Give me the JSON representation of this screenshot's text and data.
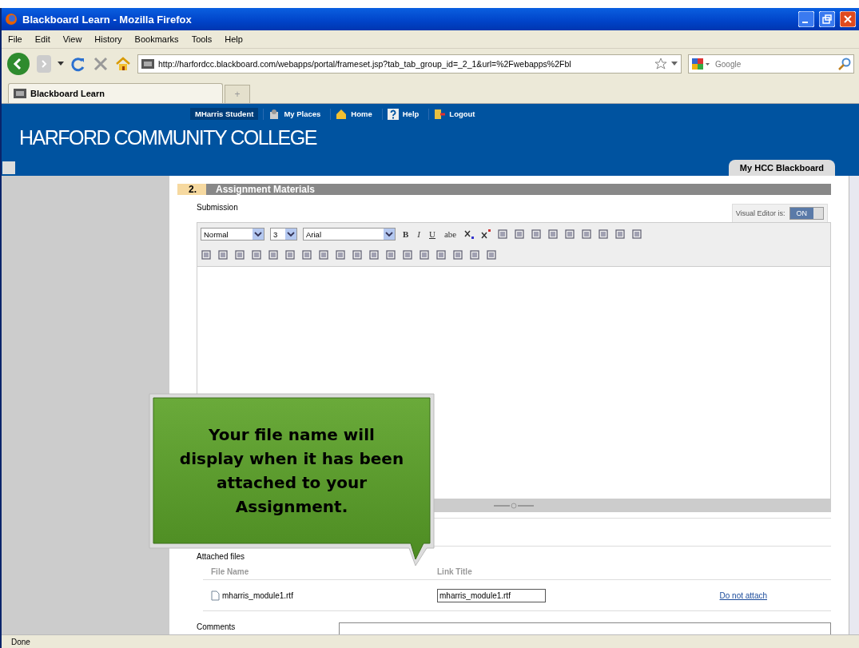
{
  "window": {
    "title": "Blackboard Learn - Mozilla Firefox"
  },
  "menu": [
    "File",
    "Edit",
    "View",
    "History",
    "Bookmarks",
    "Tools",
    "Help"
  ],
  "address_bar": {
    "value": "http://harfordcc.blackboard.com/webapps/portal/frameset.jsp?tab_tab_group_id=_2_1&url=%2Fwebapps%2Fbl"
  },
  "search": {
    "placeholder": "Google"
  },
  "tabs": [
    {
      "label": "Blackboard Learn",
      "selected": true
    }
  ],
  "new_tab": "+",
  "header": {
    "logo": "HARFORD COMMUNITY COLLEGE",
    "user": "MHarris Student",
    "links": [
      "My Places",
      "Home",
      "Help",
      "Logout"
    ],
    "tab": "My HCC Blackboard"
  },
  "section": {
    "number": "2.",
    "title": "Assignment Materials"
  },
  "submission_label": "Submission",
  "visual_editor": {
    "label": "Visual Editor is:",
    "state": "ON",
    "on": true
  },
  "editor": {
    "style": "Normal",
    "size": "3",
    "font": "Arial",
    "format_buttons": [
      "B",
      "I",
      "U",
      "abe"
    ]
  },
  "attached": {
    "label": "Attached files",
    "columns": [
      "File Name",
      "Link Title"
    ],
    "rows": [
      {
        "file": "mharris_module1.rtf",
        "link_title": "mharris_module1.rtf",
        "action": "Do not attach"
      }
    ]
  },
  "comments_label": "Comments",
  "callout": "Your file name will display when it has been attached to your Assignment.",
  "status_bar": "Done"
}
